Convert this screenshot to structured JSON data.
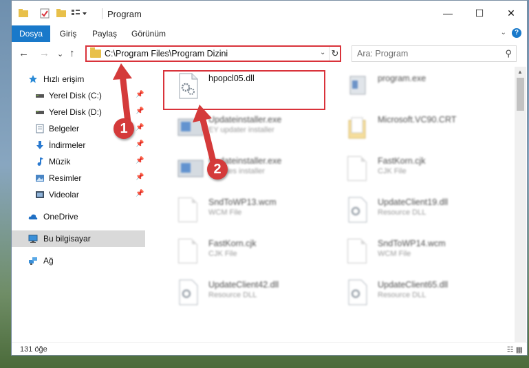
{
  "window": {
    "title": "Program",
    "controls": {
      "minimize": "—",
      "maximize": "☐",
      "close": "✕"
    }
  },
  "ribbon": {
    "tabs": [
      "Dosya",
      "Giriş",
      "Paylaş",
      "Görünüm"
    ],
    "active_tab": "Dosya",
    "collapse_glyph": "⌄",
    "help_glyph": "?"
  },
  "nav": {
    "back": "←",
    "forward": "→",
    "recent": "⌄",
    "up": "↑",
    "address": "C:\\Program Files\\Program Dizini",
    "address_dropdown": "⌄",
    "refresh": "↻",
    "search_placeholder": "Ara: Program",
    "search_icon": "⚲"
  },
  "sidebar": {
    "items": [
      {
        "label": "Hızlı erişim",
        "icon": "star-icon",
        "pinned": false
      },
      {
        "label": "Yerel Disk (C:)",
        "icon": "drive-icon",
        "pinned": true
      },
      {
        "label": "Yerel Disk (D:)",
        "icon": "drive-icon",
        "pinned": true
      },
      {
        "label": "Belgeler",
        "icon": "documents-icon",
        "pinned": true
      },
      {
        "label": "İndirmeler",
        "icon": "download-icon",
        "pinned": true
      },
      {
        "label": "Müzik",
        "icon": "music-icon",
        "pinned": true
      },
      {
        "label": "Resimler",
        "icon": "pictures-icon",
        "pinned": true
      },
      {
        "label": "Videolar",
        "icon": "videos-icon",
        "pinned": true
      },
      {
        "label": "OneDrive",
        "icon": "cloud-icon",
        "pinned": false
      },
      {
        "label": "Bu bilgisayar",
        "icon": "computer-icon",
        "pinned": false,
        "selected": true
      },
      {
        "label": "Ağ",
        "icon": "network-icon",
        "pinned": false
      }
    ],
    "pin_glyph": "📌"
  },
  "files": [
    {
      "name": "hpopcl05.dll",
      "subtitle": "",
      "icon": "dll-icon",
      "highlighted": true
    },
    {
      "name": "program.exe",
      "subtitle": "",
      "icon": "exe-icon",
      "blurred": true
    },
    {
      "name": "Updateinstaller.exe",
      "subtitle": "EY updater installer",
      "icon": "installer-icon",
      "blurred": true
    },
    {
      "name": "Microsoft.VC90.CRT",
      "subtitle": "",
      "icon": "folder-icon",
      "blurred": true
    },
    {
      "name": "Updateinstaller.exe",
      "subtitle": "Updates installer",
      "icon": "installer-icon",
      "blurred": true
    },
    {
      "name": "FastKorn.cjk",
      "subtitle": "CJK File",
      "icon": "file-icon",
      "blurred": true
    },
    {
      "name": "SndToWP13.wcm",
      "subtitle": "WCM File",
      "icon": "file-icon",
      "blurred": true
    },
    {
      "name": "UpdateClient19.dll",
      "subtitle": "Resource DLL",
      "icon": "dll-icon",
      "blurred": true
    },
    {
      "name": "FastKorn.cjk",
      "subtitle": "CJK File",
      "icon": "file-icon",
      "blurred": true
    },
    {
      "name": "SndToWP14.wcm",
      "subtitle": "WCM File",
      "icon": "file-icon",
      "blurred": true
    },
    {
      "name": "UpdateClient42.dll",
      "subtitle": "Resource DLL",
      "icon": "dll-icon",
      "blurred": true
    },
    {
      "name": "UpdateClient65.dll",
      "subtitle": "Resource DLL",
      "icon": "dll-icon",
      "blurred": true
    }
  ],
  "status": {
    "item_count": "131 öğe",
    "view_icons": "☷ ▦"
  },
  "annotations": {
    "badge1": "1",
    "badge2": "2",
    "color": "#d43a3a"
  },
  "colors": {
    "accent": "#1979ca",
    "highlight": "#d9323a"
  }
}
